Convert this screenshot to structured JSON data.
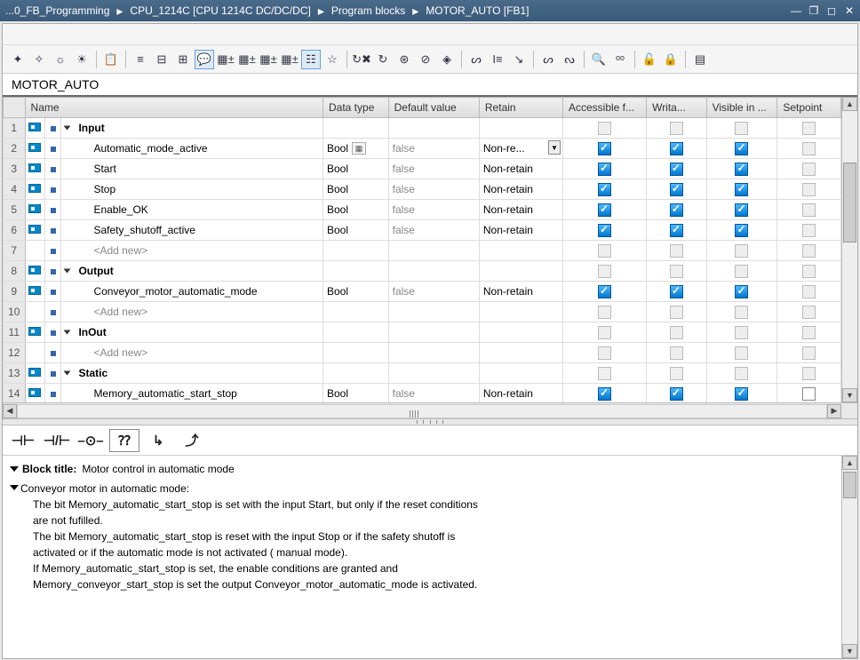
{
  "titlebar": {
    "crumb1": "...0_FB_Programming",
    "crumb2": "CPU_1214C [CPU 1214C DC/DC/DC]",
    "crumb3": "Program blocks",
    "crumb4": "MOTOR_AUTO [FB1]"
  },
  "block_name": "MOTOR_AUTO",
  "columns": {
    "name": "Name",
    "datatype": "Data type",
    "default": "Default value",
    "retain": "Retain",
    "accessible": "Accessible f...",
    "writable": "Writa...",
    "visible": "Visible in ...",
    "setpoint": "Setpoint"
  },
  "rows": [
    {
      "num": "1",
      "kind": "section",
      "name": "Input"
    },
    {
      "num": "2",
      "kind": "var",
      "name": "Automatic_mode_active",
      "dt": "Bool",
      "dtBtn": true,
      "def": "false",
      "retain": "Non-re...",
      "retainDd": true,
      "acc": true,
      "wr": true,
      "vis": true,
      "sp": "dim"
    },
    {
      "num": "3",
      "kind": "var",
      "name": "Start",
      "dt": "Bool",
      "def": "false",
      "retain": "Non-retain",
      "acc": true,
      "wr": true,
      "vis": true,
      "sp": "dim"
    },
    {
      "num": "4",
      "kind": "var",
      "name": "Stop",
      "dt": "Bool",
      "def": "false",
      "retain": "Non-retain",
      "acc": true,
      "wr": true,
      "vis": true,
      "sp": "dim"
    },
    {
      "num": "5",
      "kind": "var",
      "name": "Enable_OK",
      "dt": "Bool",
      "def": "false",
      "retain": "Non-retain",
      "acc": true,
      "wr": true,
      "vis": true,
      "sp": "dim"
    },
    {
      "num": "6",
      "kind": "var",
      "name": "Safety_shutoff_active",
      "dt": "Bool",
      "def": "false",
      "retain": "Non-retain",
      "acc": true,
      "wr": true,
      "vis": true,
      "sp": "dim"
    },
    {
      "num": "7",
      "kind": "add",
      "name": "<Add new>"
    },
    {
      "num": "8",
      "kind": "section",
      "name": "Output"
    },
    {
      "num": "9",
      "kind": "var",
      "name": "Conveyor_motor_automatic_mode",
      "dt": "Bool",
      "def": "false",
      "retain": "Non-retain",
      "acc": true,
      "wr": true,
      "vis": true,
      "sp": "dim"
    },
    {
      "num": "10",
      "kind": "add",
      "name": "<Add new>"
    },
    {
      "num": "11",
      "kind": "section",
      "name": "InOut"
    },
    {
      "num": "12",
      "kind": "add",
      "name": "<Add new>"
    },
    {
      "num": "13",
      "kind": "section",
      "name": "Static"
    },
    {
      "num": "14",
      "kind": "var",
      "name": "Memory_automatic_start_stop",
      "dt": "Bool",
      "def": "false",
      "retain": "Non-retain",
      "acc": true,
      "wr": true,
      "vis": true,
      "sp": "off"
    }
  ],
  "block_title_label": "Block title:",
  "block_title": "Motor control in automatic mode",
  "desc_heading": "Conveyor motor in automatic mode:",
  "desc_l1": "The bit  Memory_automatic_start_stop is set with the input Start, but only if the reset conditions",
  "desc_l2": "are not fufilled.",
  "desc_l3": "The bit  Memory_automatic_start_stop is reset with the input Stop or if the safety shutoff is",
  "desc_l4": "activated or if the automatic mode is not activated ( manual mode).",
  "desc_l5": "If Memory_automatic_start_stop is set, the enable conditions are granted and",
  "desc_l6": "Memory_conveyor_start_stop is set the output Conveyor_motor_automatic_mode is activated.",
  "lad": {
    "b1": "⊣⊢",
    "b2": "⊣/⊢",
    "b3": "–⊙–",
    "b4": "⁇",
    "b5": "↳",
    "b6": "⤴"
  }
}
